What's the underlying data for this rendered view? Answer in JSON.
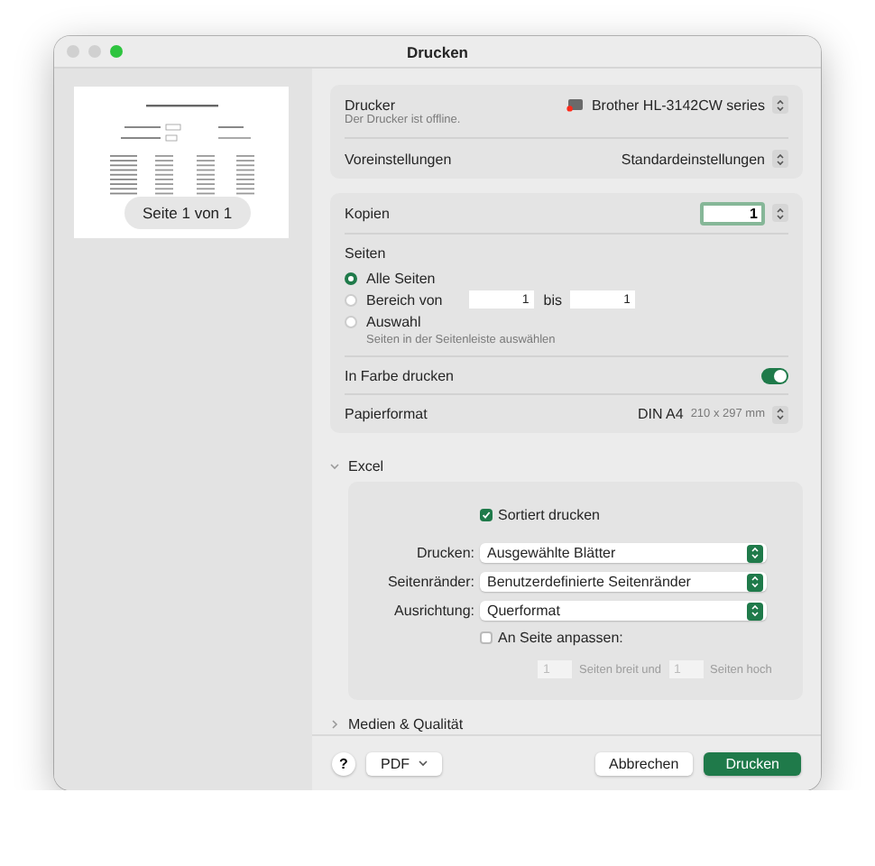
{
  "window": {
    "title": "Drucken"
  },
  "preview": {
    "page_label": "Seite 1 von 1"
  },
  "printer": {
    "label": "Drucker",
    "value": "Brother HL-3142CW series",
    "status": "Der Drucker ist offline.",
    "offline": true
  },
  "presets": {
    "label": "Voreinstellungen",
    "value": "Standardeinstellungen"
  },
  "copies": {
    "label": "Kopien",
    "value": "1"
  },
  "pages": {
    "label": "Seiten",
    "options": [
      {
        "kind": "plain",
        "label": "Alle Seiten",
        "selected": true
      },
      {
        "kind": "range",
        "label": "Bereich von",
        "selected": false,
        "from": "1",
        "to_label": "bis",
        "to": "1"
      },
      {
        "kind": "hint",
        "label": "Auswahl",
        "selected": false,
        "hint": "Seiten in der Seitenleiste auswählen"
      }
    ]
  },
  "color_print": {
    "label": "In Farbe drucken",
    "on": true
  },
  "paper": {
    "label": "Papierformat",
    "value": "DIN A4",
    "detail": "210 x 297 mm"
  },
  "excel": {
    "title": "Excel",
    "expanded": true,
    "collated": {
      "label": "Sortiert drucken",
      "checked": true
    },
    "selects": [
      {
        "label": "Drucken:",
        "value": "Ausgewählte Blätter"
      },
      {
        "label": "Seitenränder:",
        "value": "Benutzerdefinierte Seitenränder"
      },
      {
        "label": "Ausrichtung:",
        "value": "Querformat"
      }
    ],
    "fit": {
      "label": "An Seite anpassen:",
      "checked": false,
      "disabled": true,
      "wide": "1",
      "wide_label": "Seiten breit und",
      "tall": "1",
      "tall_label": "Seiten hoch"
    }
  },
  "media_section": {
    "title": "Medien & Qualität",
    "expanded": false
  },
  "footer": {
    "help": "?",
    "pdf": "PDF",
    "cancel": "Abbrechen",
    "print": "Drucken"
  }
}
